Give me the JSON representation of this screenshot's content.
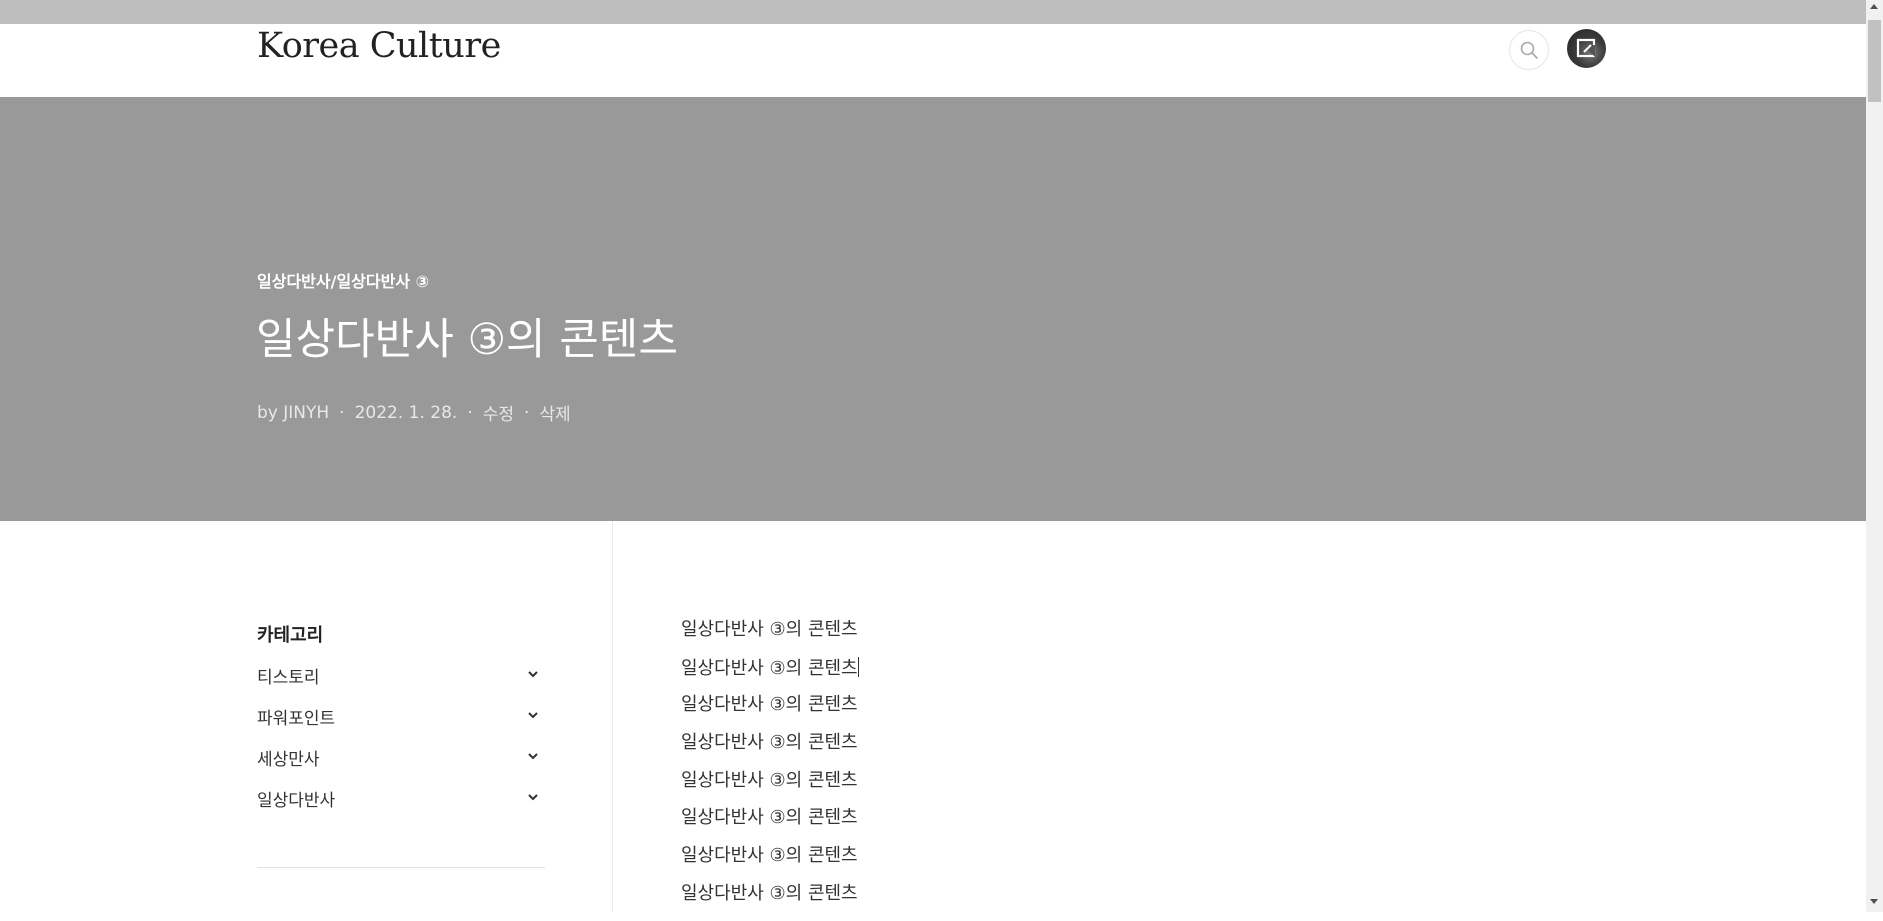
{
  "header": {
    "logo": "Korea Culture",
    "search_icon": "search-icon",
    "avatar_icon": "profile-avatar-icon"
  },
  "hero": {
    "breadcrumb": "일상다반사/일상다반사 ③",
    "title": "일상다반사 ③의 콘텐츠",
    "author": "by JINYH",
    "date": "2022. 1. 28.",
    "edit_label": "수정",
    "delete_label": "삭제",
    "separator": "·"
  },
  "sidebar": {
    "title": "카테고리",
    "items": [
      {
        "label": "티스토리",
        "icon": "chevron-down-icon"
      },
      {
        "label": "파워포인트",
        "icon": "chevron-down-icon"
      },
      {
        "label": "세상만사",
        "icon": "chevron-down-icon"
      },
      {
        "label": "일상다반사",
        "icon": "chevron-down-icon"
      }
    ]
  },
  "content": {
    "lines": [
      "일상다반사 ③의 콘텐츠",
      "일상다반사 ③의 콘텐츠",
      "일상다반사 ③의 콘텐츠",
      "일상다반사 ③의 콘텐츠",
      "일상다반사 ③의 콘텐츠",
      "일상다반사 ③의 콘텐츠",
      "일상다반사 ③의 콘텐츠",
      "일상다반사 ③의 콘텐츠"
    ]
  },
  "colors": {
    "hero_bg": "#999999",
    "top_strip": "#bdbdbd",
    "text_dark": "#333333"
  }
}
